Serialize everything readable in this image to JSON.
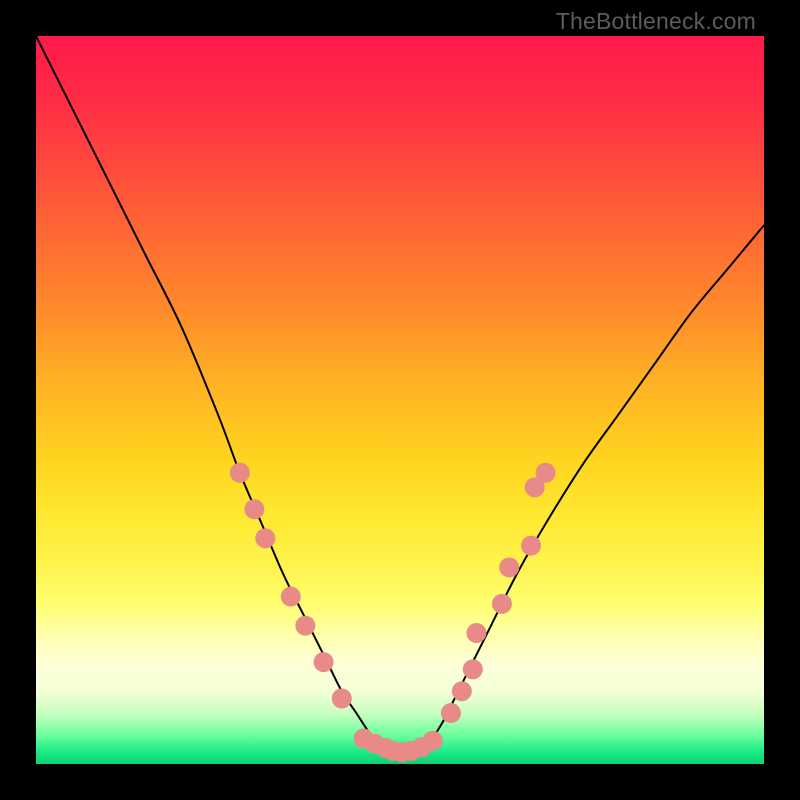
{
  "watermark": "TheBottleneck.com",
  "chart_data": {
    "type": "line",
    "title": "",
    "xlabel": "",
    "ylabel": "",
    "xlim": [
      0,
      100
    ],
    "ylim": [
      0,
      100
    ],
    "series": [
      {
        "name": "bottleneck-curve",
        "x": [
          0,
          5,
          10,
          15,
          20,
          25,
          28,
          31,
          34,
          37,
          40,
          42,
          44,
          46,
          48,
          50,
          52,
          54,
          56,
          58,
          62,
          66,
          70,
          75,
          80,
          85,
          90,
          95,
          100
        ],
        "y": [
          100,
          90,
          80,
          70,
          60,
          48,
          40,
          33,
          26,
          20,
          14,
          10,
          7,
          4,
          2,
          1,
          1.5,
          3,
          6,
          10,
          18,
          26,
          33,
          41,
          48,
          55,
          62,
          68,
          74
        ]
      }
    ],
    "markers": {
      "name": "highlight-points",
      "color": "#e88a87",
      "points": [
        {
          "x": 28,
          "y": 40
        },
        {
          "x": 30,
          "y": 35
        },
        {
          "x": 31.5,
          "y": 31
        },
        {
          "x": 35,
          "y": 23
        },
        {
          "x": 37,
          "y": 19
        },
        {
          "x": 39.5,
          "y": 14
        },
        {
          "x": 42,
          "y": 9
        },
        {
          "x": 45,
          "y": 3.5
        },
        {
          "x": 46.5,
          "y": 2.8
        },
        {
          "x": 48,
          "y": 2.2
        },
        {
          "x": 49,
          "y": 1.8
        },
        {
          "x": 50.2,
          "y": 1.6
        },
        {
          "x": 51.5,
          "y": 1.8
        },
        {
          "x": 53,
          "y": 2.3
        },
        {
          "x": 54.5,
          "y": 3.2
        },
        {
          "x": 57,
          "y": 7
        },
        {
          "x": 58.5,
          "y": 10
        },
        {
          "x": 60,
          "y": 13
        },
        {
          "x": 60.5,
          "y": 18
        },
        {
          "x": 64,
          "y": 22
        },
        {
          "x": 65,
          "y": 27
        },
        {
          "x": 68,
          "y": 30
        },
        {
          "x": 68.5,
          "y": 38
        },
        {
          "x": 70,
          "y": 40
        }
      ]
    },
    "gradient_bands": [
      {
        "color": "#ff1a4a",
        "stop": 0
      },
      {
        "color": "#ffd41f",
        "stop": 58
      },
      {
        "color": "#ffff70",
        "stop": 78
      },
      {
        "color": "#17e886",
        "stop": 98
      }
    ]
  }
}
